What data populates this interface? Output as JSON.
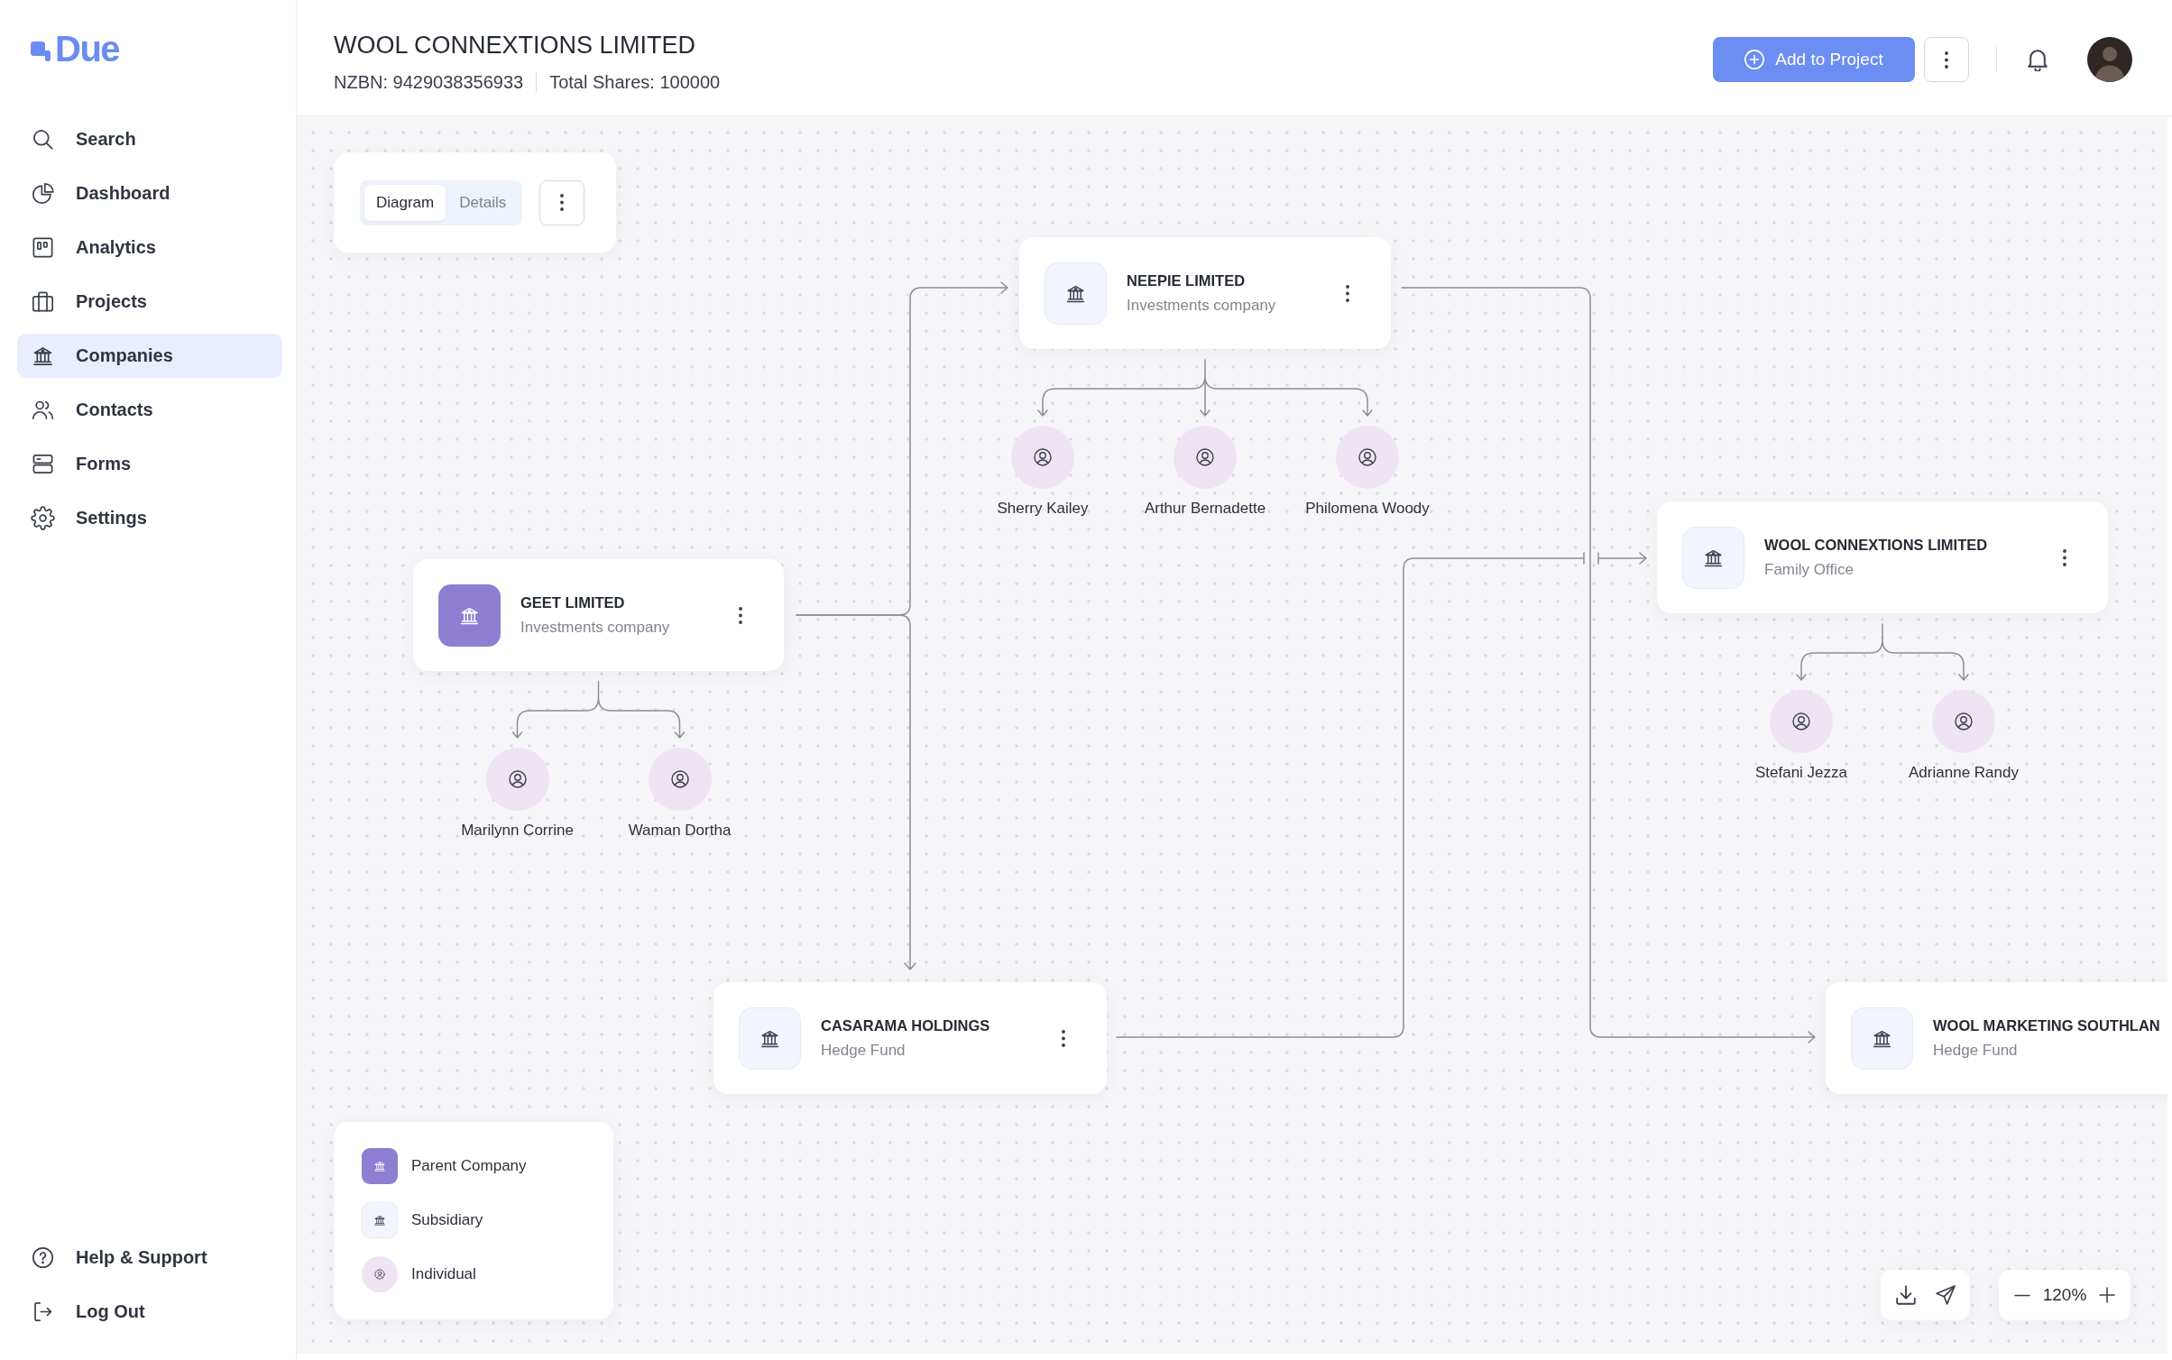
{
  "sidebar": {
    "logo": "Due",
    "nav": [
      {
        "label": "Search",
        "selected": false
      },
      {
        "label": "Dashboard",
        "selected": false
      },
      {
        "label": "Analytics",
        "selected": false
      },
      {
        "label": "Projects",
        "selected": false
      },
      {
        "label": "Companies",
        "selected": true
      },
      {
        "label": "Contacts",
        "selected": false
      },
      {
        "label": "Forms",
        "selected": false
      },
      {
        "label": "Settings",
        "selected": false
      }
    ],
    "footer": [
      {
        "label": "Help & Support"
      },
      {
        "label": "Log Out"
      }
    ]
  },
  "header": {
    "title": "WOOL CONNEXTIONS LIMITED",
    "nzbn": "NZBN: 9429038356933",
    "total_shares": "Total Shares: 100000",
    "add_button": "Add to Project"
  },
  "view_toggle": {
    "tabs": [
      {
        "label": "Diagram",
        "selected": true
      },
      {
        "label": "Details",
        "selected": false
      }
    ]
  },
  "diagram": {
    "companies": [
      {
        "name": "GEET LIMITED",
        "type": "Investments company",
        "kind": "parent",
        "individuals": [
          {
            "name": "Marilynn Corrine"
          },
          {
            "name": "Waman Dortha"
          }
        ],
        "children": [
          {
            "name": "NEEPIE LIMITED",
            "type": "Investments company",
            "kind": "subsidiary",
            "individuals": [
              {
                "name": "Sherry Kailey"
              },
              {
                "name": "Arthur Bernadette"
              },
              {
                "name": "Philomena Woody"
              }
            ],
            "children": [
              {
                "name": "WOOL MARKETING SOUTHLAN",
                "type": "Hedge Fund",
                "kind": "subsidiary"
              }
            ]
          },
          {
            "name": "CASARAMA HOLDINGS",
            "type": "Hedge Fund",
            "kind": "subsidiary",
            "children": [
              {
                "name": "WOOL CONNEXTIONS LIMITED",
                "type": "Family Office",
                "kind": "subsidiary",
                "individuals": [
                  {
                    "name": "Stefani Jezza"
                  },
                  {
                    "name": "Adrianne Randy"
                  }
                ]
              }
            ]
          }
        ]
      }
    ]
  },
  "legend": [
    {
      "kind": "parent",
      "label": "Parent Company"
    },
    {
      "kind": "subsidiary",
      "label": "Subsidiary"
    },
    {
      "kind": "individual",
      "label": "Individual"
    }
  ],
  "zoom": {
    "value": "120%"
  }
}
